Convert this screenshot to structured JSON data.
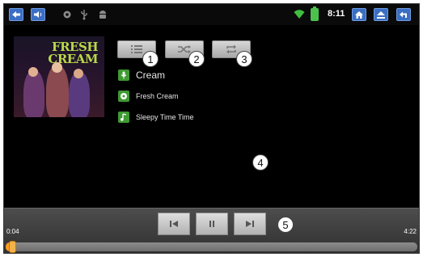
{
  "status_bar": {
    "left_icons": [
      "back-arrow-icon",
      "volume-icon",
      "settings-icon",
      "usb-icon",
      "android-icon"
    ],
    "time": "8:11",
    "right_icons": [
      "wifi-icon",
      "battery-icon",
      "home-icon",
      "eject-icon",
      "return-icon"
    ]
  },
  "album": {
    "art_title_line1": "FRESH",
    "art_title_line2": "CREAM"
  },
  "controls": [
    {
      "icon": "playlist-icon",
      "callout": "1"
    },
    {
      "icon": "shuffle-icon",
      "callout": "2"
    },
    {
      "icon": "repeat-icon",
      "callout": "3"
    }
  ],
  "track": {
    "artist": "Cream",
    "album": "Fresh Cream",
    "title": "Sleepy Time Time"
  },
  "main_callout": "4",
  "transport": {
    "callout": "5",
    "elapsed": "0:04",
    "total": "4:22",
    "progress_fraction": 0.02
  },
  "colors": {
    "accent_green": "#3f9a32",
    "progress_orange": "#ff9a1c",
    "status_blue": "#3b6fc4"
  }
}
